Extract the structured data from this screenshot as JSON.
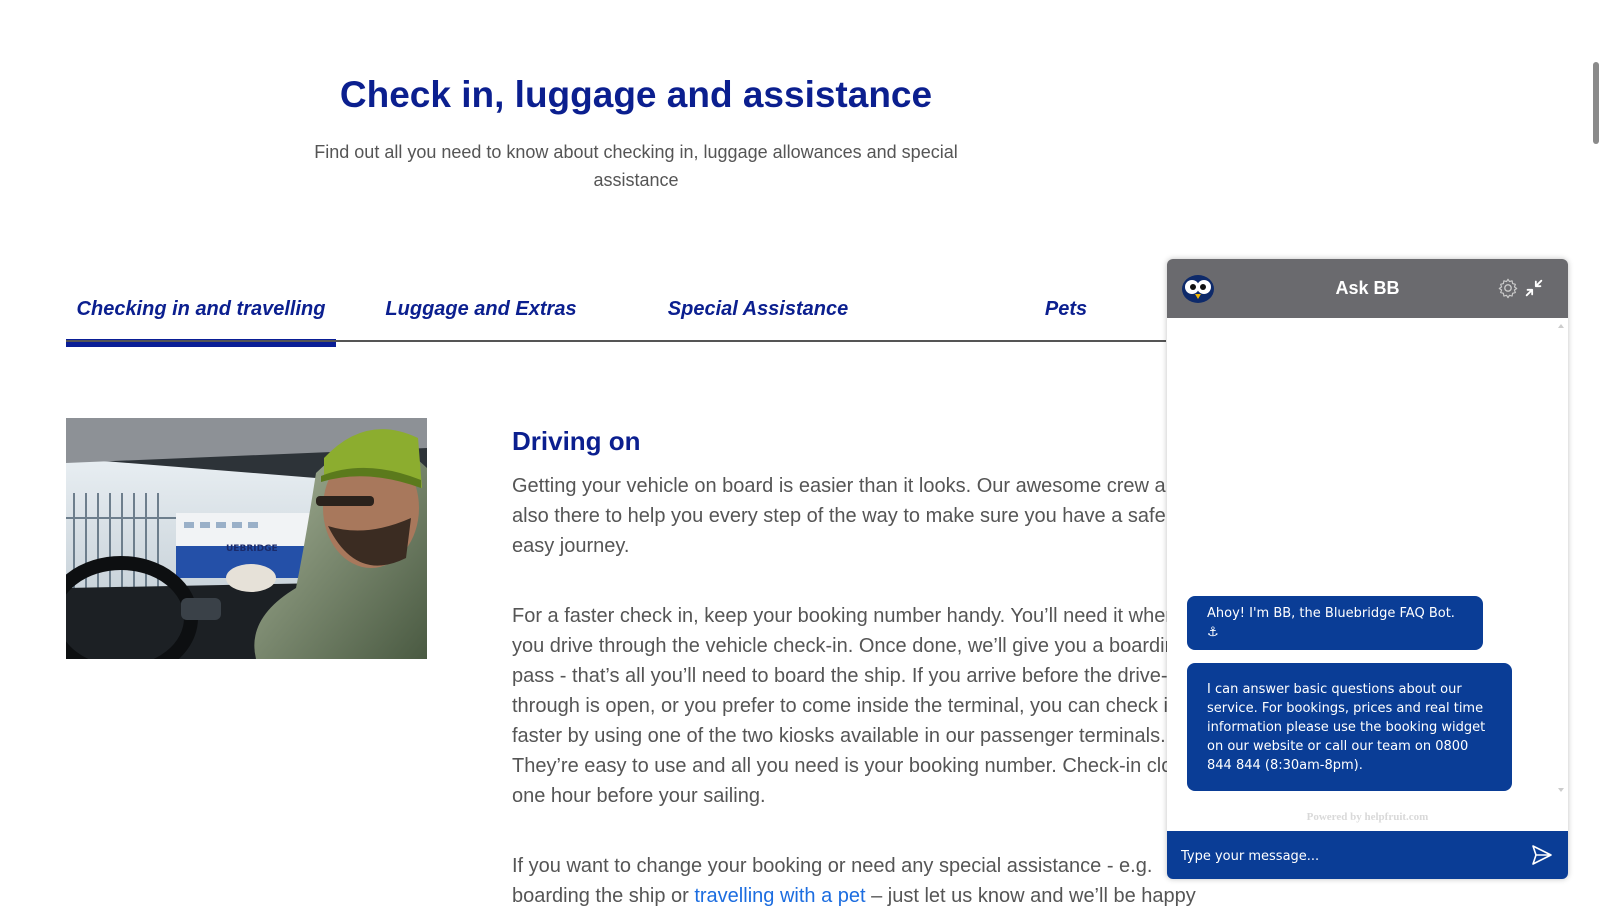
{
  "hero": {
    "title": "Check in, luggage and assistance",
    "subtitle": "Find out all you need to know about checking in, luggage allowances and special assistance"
  },
  "tabs": [
    {
      "label": "Checking in and travelling",
      "active": true
    },
    {
      "label": "Luggage and Extras",
      "active": false
    },
    {
      "label": "Special Assistance",
      "active": false
    },
    {
      "label": "Pets",
      "active": false
    }
  ],
  "section": {
    "heading": "Driving on",
    "paragraph1": "Getting your vehicle on board is easier than it looks. Our awesome crew are also there to help you every step of the way to make sure you have a safe and easy journey.",
    "paragraph2": "For a faster check in, keep your booking number handy. You’ll need it when you drive through the vehicle check-in. Once done, we’ll give you a boarding pass - that’s all you’ll need to board the ship. If you arrive before the drive-through is open, or you prefer to come inside the terminal, you can check in faster by using one of the two kiosks available in our passenger terminals. They’re easy to use and all you need is your booking number. Check-in closes one hour before your sailing.",
    "paragraph3_before": "If you want to change your booking or need any special assistance - e.g. boarding the ship or ",
    "paragraph3_link": "travelling with a pet",
    "paragraph3_after": " – just let us know and we’ll be happy"
  },
  "photo": {
    "icon": "driver-in-car-photo",
    "ship_label": "UEBRIDGE"
  },
  "chat": {
    "title": "Ask BB",
    "messages": [
      "Ahoy! I'm BB, the Bluebridge FAQ Bot. ⚓",
      "I can answer basic questions about our service. For bookings, prices and real time information please use the booking widget on our website or call our team on 0800 844 844 (8:30am-8pm)."
    ],
    "powered_by": "Powered by helpfruit.com",
    "input_placeholder": "Type your message...",
    "colors": {
      "header": "#6a6a6e",
      "bubble": "#0a3d96",
      "input_bar": "#0a3d96"
    }
  },
  "colors": {
    "brand_navy": "#0b1f8f",
    "body_text": "#555555",
    "link": "#1c6de0"
  }
}
